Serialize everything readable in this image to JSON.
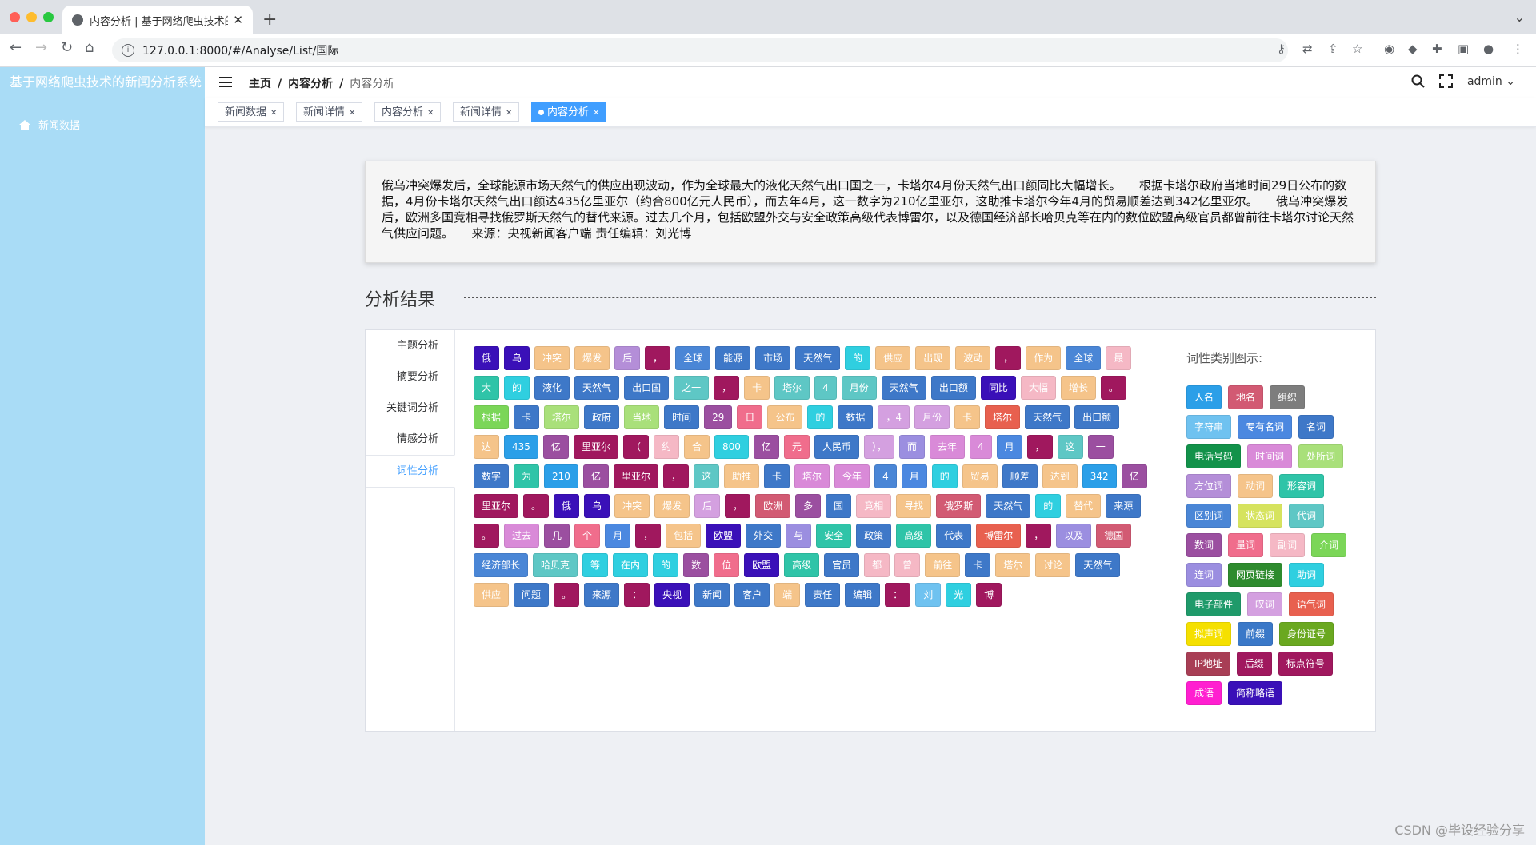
{
  "browser": {
    "tab_title": "内容分析 | 基于网络爬虫技术的新",
    "url": "127.0.0.1:8000/#/Analyse/List/国际"
  },
  "app": {
    "brand": "基于网络爬虫技术的新闻分析系统",
    "sidebar_item": "新闻数据",
    "breadcrumb": [
      "主页",
      "内容分析",
      "内容分析"
    ],
    "user": "admin"
  },
  "tags": [
    {
      "label": "新闻数据",
      "active": false
    },
    {
      "label": "新闻详情",
      "active": false
    },
    {
      "label": "内容分析",
      "active": false
    },
    {
      "label": "新闻详情",
      "active": false
    },
    {
      "label": "内容分析",
      "active": true
    }
  ],
  "article_text": "俄乌冲突爆发后，全球能源市场天然气的供应出现波动，作为全球最大的液化天然气出口国之一，卡塔尔4月份天然气出口额同比大幅增长。　　根据卡塔尔政府当地时间29日公布的数据，4月份卡塔尔天然气出口额达435亿里亚尔（约合800亿元人民币），而去年4月，这一数字为210亿里亚尔，这助推卡塔尔今年4月的贸易顺差达到342亿里亚尔。　　俄乌冲突爆发后，欧洲多国竞相寻找俄罗斯天然气的替代来源。过去几个月，包括欧盟外交与安全政策高级代表博雷尔，以及德国经济部长哈贝克等在内的数位欧盟高级官员都曾前往卡塔尔讨论天然气供应问题。　　来源：央视新闻客户端 责任编辑：刘光博",
  "section_title": "分析结果",
  "vertical_tabs": [
    {
      "label": "主题分析",
      "active": false
    },
    {
      "label": "摘要分析",
      "active": false
    },
    {
      "label": "关键词分析",
      "active": false
    },
    {
      "label": "情感分析",
      "active": false
    },
    {
      "label": "词性分析",
      "active": true
    }
  ],
  "legend_title": "词性类别图示:",
  "pos_legend": [
    {
      "label": "人名",
      "color": "#2b9fe8"
    },
    {
      "label": "地名",
      "color": "#d25a73"
    },
    {
      "label": "组织",
      "color": "#7d7d7d"
    },
    {
      "label": "字符串",
      "color": "#6fc2f0"
    },
    {
      "label": "专有名词",
      "color": "#4b88e0"
    },
    {
      "label": "名词",
      "color": "#3e78c8"
    },
    {
      "label": "电话号码",
      "color": "#12924a"
    },
    {
      "label": "时间词",
      "color": "#d98ad8"
    },
    {
      "label": "处所词",
      "color": "#a9e07a"
    },
    {
      "label": "方位词",
      "color": "#b48ed8"
    },
    {
      "label": "动词",
      "color": "#f5c48a"
    },
    {
      "label": "形容词",
      "color": "#2fc4a8"
    },
    {
      "label": "区别词",
      "color": "#4a86d6"
    },
    {
      "label": "状态词",
      "color": "#d6e35e"
    },
    {
      "label": "代词",
      "color": "#5ec7c5"
    },
    {
      "label": "数词",
      "color": "#9b4fa0"
    },
    {
      "label": "量词",
      "color": "#f06d8c"
    },
    {
      "label": "副词",
      "color": "#f5b8c5"
    },
    {
      "label": "介词",
      "color": "#7bd658"
    },
    {
      "label": "连词",
      "color": "#9b8ee0"
    },
    {
      "label": "网页链接",
      "color": "#2e8b2e"
    },
    {
      "label": "助词",
      "color": "#2fcfe0"
    },
    {
      "label": "电子部件",
      "color": "#1f9a6a"
    },
    {
      "label": "叹词",
      "color": "#d4a0e0"
    },
    {
      "label": "语气词",
      "color": "#e8604f"
    },
    {
      "label": "拟声词",
      "color": "#f5e000"
    },
    {
      "label": "前缀",
      "color": "#3a78c8"
    },
    {
      "label": "身份证号",
      "color": "#6aa820"
    },
    {
      "label": "IP地址",
      "color": "#a83e55"
    },
    {
      "label": "后缀",
      "color": "#a0185e"
    },
    {
      "label": "标点符号",
      "color": "#a0185e"
    },
    {
      "label": "成语",
      "color": "#ff1fd0"
    },
    {
      "label": "简称略语",
      "color": "#3a10b8"
    }
  ],
  "tokens": [
    {
      "w": "俄",
      "c": "#3a10b8"
    },
    {
      "w": "乌",
      "c": "#3a10b8"
    },
    {
      "w": "冲突",
      "c": "#f5c48a"
    },
    {
      "w": "爆发",
      "c": "#f5c48a"
    },
    {
      "w": "后",
      "c": "#b48ed8"
    },
    {
      "w": "，",
      "c": "#a0185e"
    },
    {
      "w": "全球",
      "c": "#4a86d6"
    },
    {
      "w": "能源",
      "c": "#3e78c8"
    },
    {
      "w": "市场",
      "c": "#3e78c8"
    },
    {
      "w": "天然气",
      "c": "#3e78c8"
    },
    {
      "w": "的",
      "c": "#2fcfe0"
    },
    {
      "w": "供应",
      "c": "#f5c48a"
    },
    {
      "w": "出现",
      "c": "#f5c48a"
    },
    {
      "w": "波动",
      "c": "#f5c48a"
    },
    {
      "w": "，",
      "c": "#a0185e"
    },
    {
      "w": "作为",
      "c": "#f5c48a"
    },
    {
      "w": "全球",
      "c": "#4a86d6"
    },
    {
      "w": "最",
      "c": "#f5b8c5"
    },
    {
      "w": "大",
      "c": "#2fc4a8"
    },
    {
      "w": "的",
      "c": "#2fcfe0"
    },
    {
      "w": "液化",
      "c": "#3e78c8"
    },
    {
      "w": "天然气",
      "c": "#3e78c8"
    },
    {
      "w": "出口国",
      "c": "#3e78c8"
    },
    {
      "w": "之一",
      "c": "#5ec7c5"
    },
    {
      "w": "，",
      "c": "#a0185e"
    },
    {
      "w": "卡",
      "c": "#f5c48a"
    },
    {
      "w": "塔尔",
      "c": "#5ec7c5"
    },
    {
      "w": "4",
      "c": "#5ec7c5"
    },
    {
      "w": "月份",
      "c": "#5ec7c5"
    },
    {
      "w": "天然气",
      "c": "#3e78c8"
    },
    {
      "w": "出口额",
      "c": "#3e78c8"
    },
    {
      "w": "同比",
      "c": "#3a10b8"
    },
    {
      "w": "大幅",
      "c": "#f5b8c5"
    },
    {
      "w": "增长",
      "c": "#f5c48a"
    },
    {
      "w": "。",
      "c": "#a0185e"
    },
    {
      "w": "根据",
      "c": "#7bd658"
    },
    {
      "w": "卡",
      "c": "#3e78c8"
    },
    {
      "w": "塔尔",
      "c": "#a9e07a"
    },
    {
      "w": "政府",
      "c": "#3e78c8"
    },
    {
      "w": "当地",
      "c": "#a9e07a"
    },
    {
      "w": "时间",
      "c": "#3e78c8"
    },
    {
      "w": "29",
      "c": "#9b4fa0"
    },
    {
      "w": "日",
      "c": "#f06d8c"
    },
    {
      "w": "公布",
      "c": "#f5c48a"
    },
    {
      "w": "的",
      "c": "#2fcfe0"
    },
    {
      "w": "数据",
      "c": "#3e78c8"
    },
    {
      "w": "，4",
      "c": "#d4a0e0"
    },
    {
      "w": "月份",
      "c": "#d4a0e0"
    },
    {
      "w": "卡",
      "c": "#f5c48a"
    },
    {
      "w": "塔尔",
      "c": "#e8604f"
    },
    {
      "w": "天然气",
      "c": "#3e78c8"
    },
    {
      "w": "出口额",
      "c": "#3e78c8"
    },
    {
      "w": "达",
      "c": "#f5c48a"
    },
    {
      "w": "435",
      "c": "#2b9fe8"
    },
    {
      "w": "亿",
      "c": "#9b4fa0"
    },
    {
      "w": "里亚尔",
      "c": "#a0185e"
    },
    {
      "w": "（",
      "c": "#a0185e"
    },
    {
      "w": "约",
      "c": "#f5b8c5"
    },
    {
      "w": "合",
      "c": "#f5c48a"
    },
    {
      "w": "800",
      "c": "#2fcfe0"
    },
    {
      "w": "亿",
      "c": "#9b4fa0"
    },
    {
      "w": "元",
      "c": "#f06d8c"
    },
    {
      "w": "人民币",
      "c": "#3e78c8"
    },
    {
      "w": "），",
      "c": "#d4a0e0"
    },
    {
      "w": "而",
      "c": "#9b8ee0"
    },
    {
      "w": "去年",
      "c": "#d98ad8"
    },
    {
      "w": "4",
      "c": "#d98ad8"
    },
    {
      "w": "月",
      "c": "#4b88e0"
    },
    {
      "w": "，",
      "c": "#a0185e"
    },
    {
      "w": "这",
      "c": "#5ec7c5"
    },
    {
      "w": "一",
      "c": "#9b4fa0"
    },
    {
      "w": "数字",
      "c": "#3e78c8"
    },
    {
      "w": "为",
      "c": "#2fc4a8"
    },
    {
      "w": "210",
      "c": "#2b9fe8"
    },
    {
      "w": "亿",
      "c": "#9b4fa0"
    },
    {
      "w": "里亚尔",
      "c": "#a0185e"
    },
    {
      "w": "，",
      "c": "#a0185e"
    },
    {
      "w": "这",
      "c": "#5ec7c5"
    },
    {
      "w": "助推",
      "c": "#f5c48a"
    },
    {
      "w": "卡",
      "c": "#3e78c8"
    },
    {
      "w": "塔尔",
      "c": "#d98ad8"
    },
    {
      "w": "今年",
      "c": "#d98ad8"
    },
    {
      "w": "4",
      "c": "#4a86d6"
    },
    {
      "w": "月",
      "c": "#4b88e0"
    },
    {
      "w": "的",
      "c": "#2fcfe0"
    },
    {
      "w": "贸易",
      "c": "#f5c48a"
    },
    {
      "w": "顺差",
      "c": "#3e78c8"
    },
    {
      "w": "达到",
      "c": "#f5c48a"
    },
    {
      "w": "342",
      "c": "#2b9fe8"
    },
    {
      "w": "亿",
      "c": "#9b4fa0"
    },
    {
      "w": "里亚尔",
      "c": "#a0185e"
    },
    {
      "w": "。",
      "c": "#a0185e"
    },
    {
      "w": "俄",
      "c": "#3a10b8"
    },
    {
      "w": "乌",
      "c": "#3a10b8"
    },
    {
      "w": "冲突",
      "c": "#f5c48a"
    },
    {
      "w": "爆发",
      "c": "#f5c48a"
    },
    {
      "w": "后",
      "c": "#d4a0e0"
    },
    {
      "w": "，",
      "c": "#a0185e"
    },
    {
      "w": "欧洲",
      "c": "#d25a73"
    },
    {
      "w": "多",
      "c": "#9b4fa0"
    },
    {
      "w": "国",
      "c": "#3e78c8"
    },
    {
      "w": "竞相",
      "c": "#f5b8c5"
    },
    {
      "w": "寻找",
      "c": "#f5c48a"
    },
    {
      "w": "俄罗斯",
      "c": "#d25a73"
    },
    {
      "w": "天然气",
      "c": "#3e78c8"
    },
    {
      "w": "的",
      "c": "#2fcfe0"
    },
    {
      "w": "替代",
      "c": "#f5c48a"
    },
    {
      "w": "来源",
      "c": "#3e78c8"
    },
    {
      "w": "。",
      "c": "#a0185e"
    },
    {
      "w": "过去",
      "c": "#d98ad8"
    },
    {
      "w": "几",
      "c": "#9b4fa0"
    },
    {
      "w": "个",
      "c": "#f06d8c"
    },
    {
      "w": "月",
      "c": "#4b88e0"
    },
    {
      "w": "，",
      "c": "#a0185e"
    },
    {
      "w": "包括",
      "c": "#f5c48a"
    },
    {
      "w": "欧盟",
      "c": "#3a10b8"
    },
    {
      "w": "外交",
      "c": "#3e78c8"
    },
    {
      "w": "与",
      "c": "#9b8ee0"
    },
    {
      "w": "安全",
      "c": "#2fc4a8"
    },
    {
      "w": "政策",
      "c": "#3e78c8"
    },
    {
      "w": "高级",
      "c": "#2fc4a8"
    },
    {
      "w": "代表",
      "c": "#3e78c8"
    },
    {
      "w": "博雷尔",
      "c": "#e8604f"
    },
    {
      "w": "，",
      "c": "#a0185e"
    },
    {
      "w": "以及",
      "c": "#9b8ee0"
    },
    {
      "w": "德国",
      "c": "#d25a73"
    },
    {
      "w": "经济部长",
      "c": "#4a86d6"
    },
    {
      "w": "哈贝克",
      "c": "#5ec7c5"
    },
    {
      "w": "等",
      "c": "#2fcfe0"
    },
    {
      "w": "在内",
      "c": "#2fcfe0"
    },
    {
      "w": "的",
      "c": "#2fcfe0"
    },
    {
      "w": "数",
      "c": "#9b4fa0"
    },
    {
      "w": "位",
      "c": "#f06d8c"
    },
    {
      "w": "欧盟",
      "c": "#3a10b8"
    },
    {
      "w": "高级",
      "c": "#2fc4a8"
    },
    {
      "w": "官员",
      "c": "#3e78c8"
    },
    {
      "w": "都",
      "c": "#f5b8c5"
    },
    {
      "w": "曾",
      "c": "#f5b8c5"
    },
    {
      "w": "前往",
      "c": "#f5c48a"
    },
    {
      "w": "卡",
      "c": "#3e78c8"
    },
    {
      "w": "塔尔",
      "c": "#f5c48a"
    },
    {
      "w": "讨论",
      "c": "#f5c48a"
    },
    {
      "w": "天然气",
      "c": "#3e78c8"
    },
    {
      "w": "供应",
      "c": "#f5c48a"
    },
    {
      "w": "问题",
      "c": "#3e78c8"
    },
    {
      "w": "。",
      "c": "#a0185e"
    },
    {
      "w": "来源",
      "c": "#3e78c8"
    },
    {
      "w": "：",
      "c": "#a0185e"
    },
    {
      "w": "央视",
      "c": "#3a10b8"
    },
    {
      "w": "新闻",
      "c": "#3e78c8"
    },
    {
      "w": "客户",
      "c": "#3e78c8"
    },
    {
      "w": "端",
      "c": "#f5c48a"
    },
    {
      "w": "责任",
      "c": "#3e78c8"
    },
    {
      "w": "编辑",
      "c": "#3e78c8"
    },
    {
      "w": "：",
      "c": "#a0185e"
    },
    {
      "w": "刘",
      "c": "#6fc2f0"
    },
    {
      "w": "光",
      "c": "#2fcfe0"
    },
    {
      "w": "博",
      "c": "#a0185e"
    }
  ],
  "watermark": "CSDN @毕设经验分享"
}
